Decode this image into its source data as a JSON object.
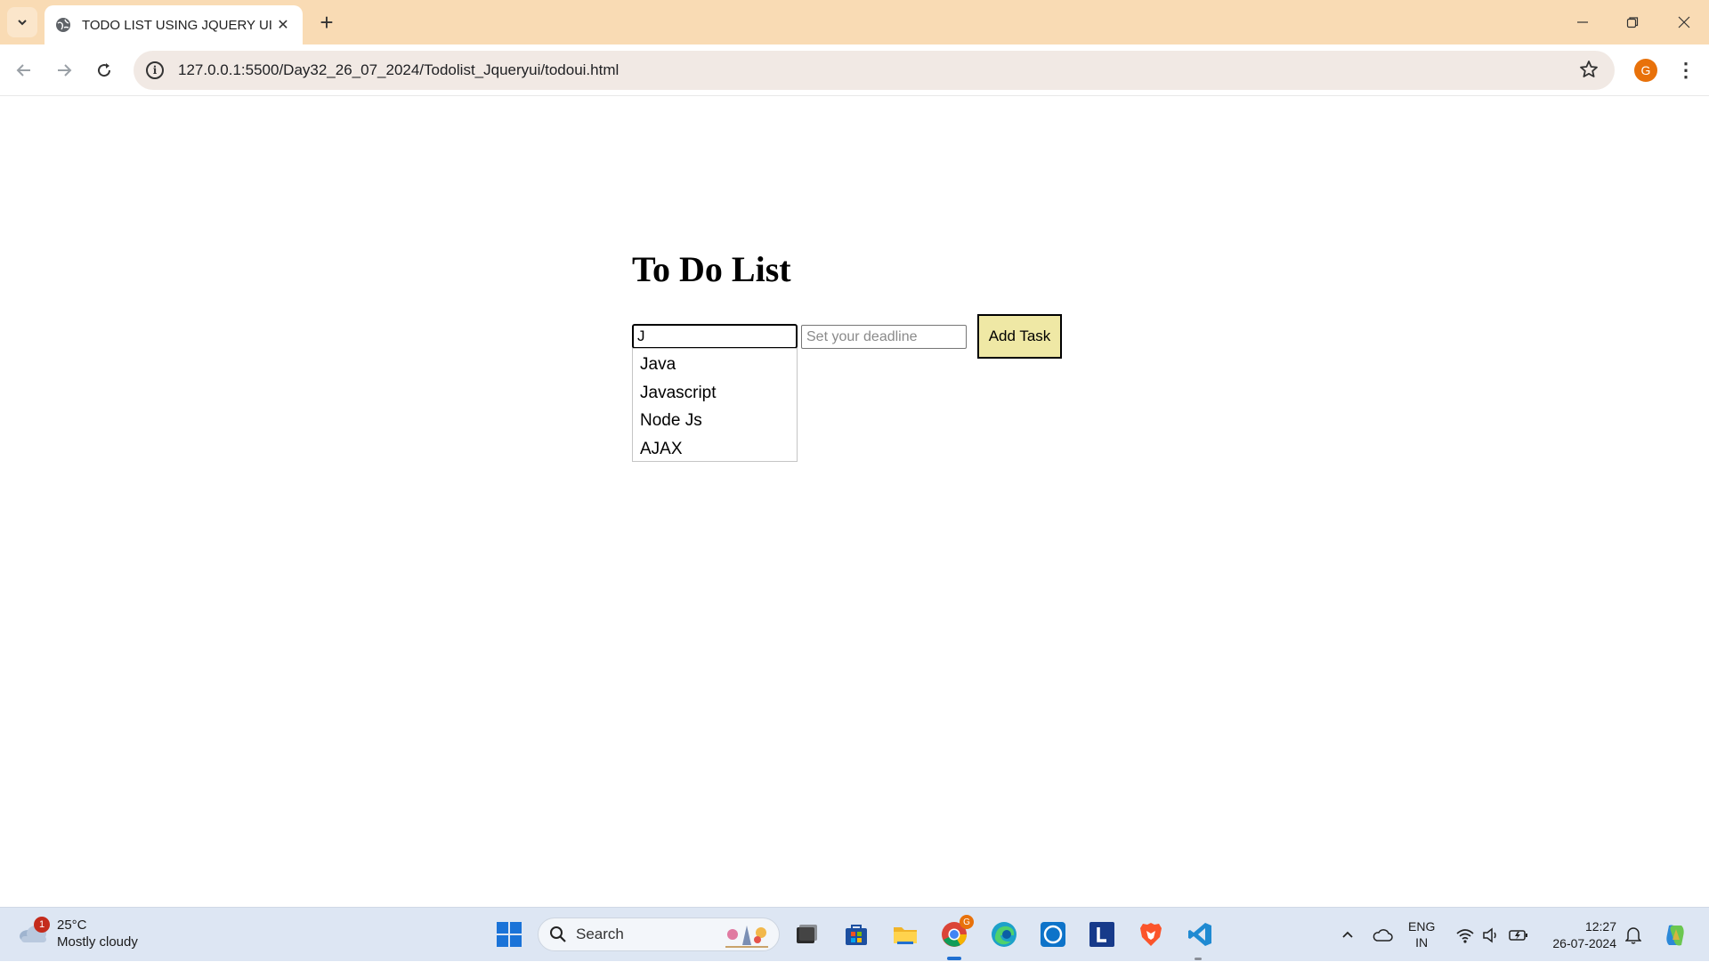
{
  "browser": {
    "tab_title": "TODO LIST USING JQUERY UI",
    "url": "127.0.0.1:5500/Day32_26_07_2024/Todolist_Jqueryui/todoui.html",
    "profile_initial": "G"
  },
  "page": {
    "heading": "To Do List",
    "task_input_value": "J",
    "deadline_placeholder": "Set your deadline",
    "add_button_label": "Add Task",
    "suggestions": [
      "Java",
      "Javascript",
      "Node Js",
      "AJAX"
    ]
  },
  "taskbar": {
    "weather_badge": "1",
    "temperature": "25°C",
    "condition": "Mostly cloudy",
    "search_label": "Search",
    "lang_top": "ENG",
    "lang_bottom": "IN",
    "time": "12:27",
    "date": "26-07-2024",
    "chrome_badge": "G",
    "app_icons": [
      "file-explorer-icon",
      "microsoft-store-icon",
      "folder-icon",
      "chrome-icon",
      "edge-icon",
      "alexa-icon",
      "l-app-icon",
      "brave-icon",
      "vscode-icon"
    ]
  },
  "colors": {
    "tabbar_bg": "#f9dbb4",
    "add_button_bg": "#efe8a5",
    "taskbar_bg": "#dde6f3"
  }
}
